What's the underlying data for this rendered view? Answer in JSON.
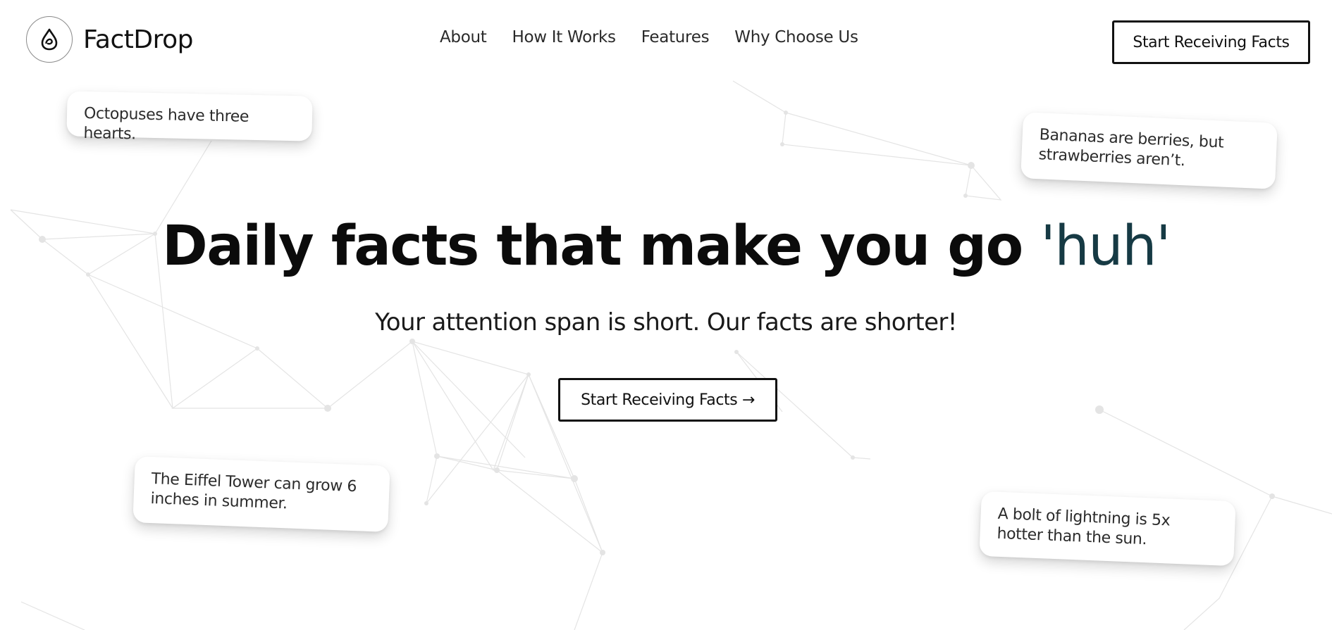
{
  "brand": {
    "name": "FactDrop",
    "logo_icon": "droplet-icon"
  },
  "nav": {
    "items": [
      {
        "label": "About"
      },
      {
        "label": "How It Works"
      },
      {
        "label": "Features"
      },
      {
        "label": "Why Choose Us"
      }
    ]
  },
  "header": {
    "cta_label": "Start Receiving Facts"
  },
  "hero": {
    "title_main": "Daily facts that make you go ",
    "title_accent": "'huh'",
    "subtitle": "Your attention span is short. Our facts are shorter!",
    "cta_label": "Start Receiving Facts →"
  },
  "fact_cards": [
    {
      "text": "Octopuses have three hearts."
    },
    {
      "text": "Bananas are berries, but strawberries aren’t."
    },
    {
      "text": "The Eiffel Tower can grow 6 inches in summer."
    },
    {
      "text": "A bolt of lightning is 5x hotter than the sun."
    }
  ],
  "colors": {
    "accent": "#163a44",
    "text": "#111111",
    "background": "#ffffff",
    "network_line": "#e6e6e6"
  }
}
